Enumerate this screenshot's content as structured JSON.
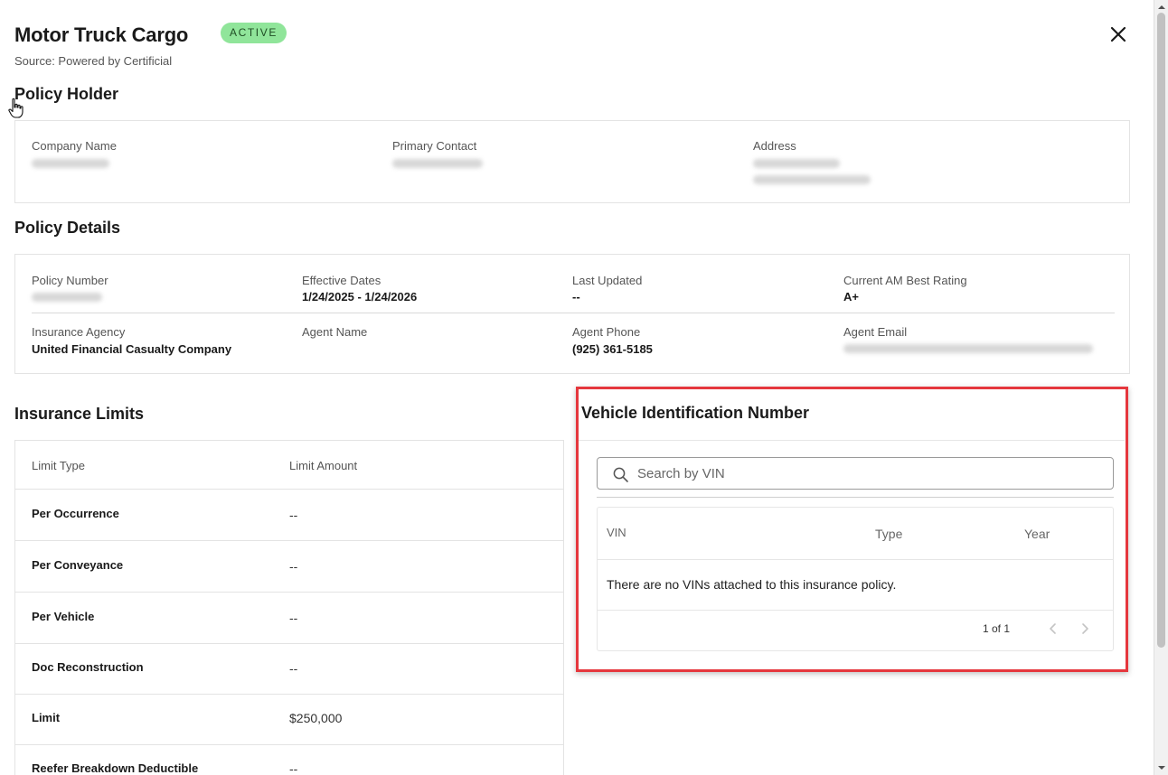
{
  "header": {
    "title": "Motor Truck Cargo",
    "status_badge": "ACTIVE",
    "source": "Source: Powered by Certificial"
  },
  "policy_holder": {
    "section_title": "Policy Holder",
    "fields": [
      {
        "label": "Company Name"
      },
      {
        "label": "Primary Contact"
      },
      {
        "label": "Address"
      }
    ]
  },
  "policy_details": {
    "section_title": "Policy Details",
    "policy_number_label": "Policy Number",
    "effective_dates_label": "Effective Dates",
    "effective_dates_value": "1/24/2025 - 1/24/2026",
    "last_updated_label": "Last Updated",
    "last_updated_value": "--",
    "am_best_label": "Current AM Best Rating",
    "am_best_value": "A+",
    "insurance_agency_label": "Insurance Agency",
    "insurance_agency_value": "United Financial Casualty Company",
    "agent_name_label": "Agent Name",
    "agent_phone_label": "Agent Phone",
    "agent_phone_value": "(925) 361-5185",
    "agent_email_label": "Agent Email"
  },
  "insurance_limits": {
    "section_title": "Insurance Limits",
    "columns": [
      "Limit Type",
      "Limit Amount"
    ],
    "rows": [
      {
        "type": "Per Occurrence",
        "amount": "--"
      },
      {
        "type": "Per Conveyance",
        "amount": "--"
      },
      {
        "type": "Per Vehicle",
        "amount": "--"
      },
      {
        "type": "Doc Reconstruction",
        "amount": "--"
      },
      {
        "type": "Limit",
        "amount": "$250,000"
      },
      {
        "type": "Reefer Breakdown Deductible",
        "amount": "--"
      }
    ]
  },
  "vin": {
    "section_title": "Vehicle Identification Number",
    "search_placeholder": "Search by VIN",
    "columns": [
      "VIN",
      "Type",
      "Year"
    ],
    "empty_message": "There are no VINs attached to this insurance policy.",
    "pagination": "1 of 1",
    "highlight_color": "#e5373d"
  },
  "colors": {
    "badge_bg": "#90e59a",
    "badge_text": "#1f4d24"
  }
}
